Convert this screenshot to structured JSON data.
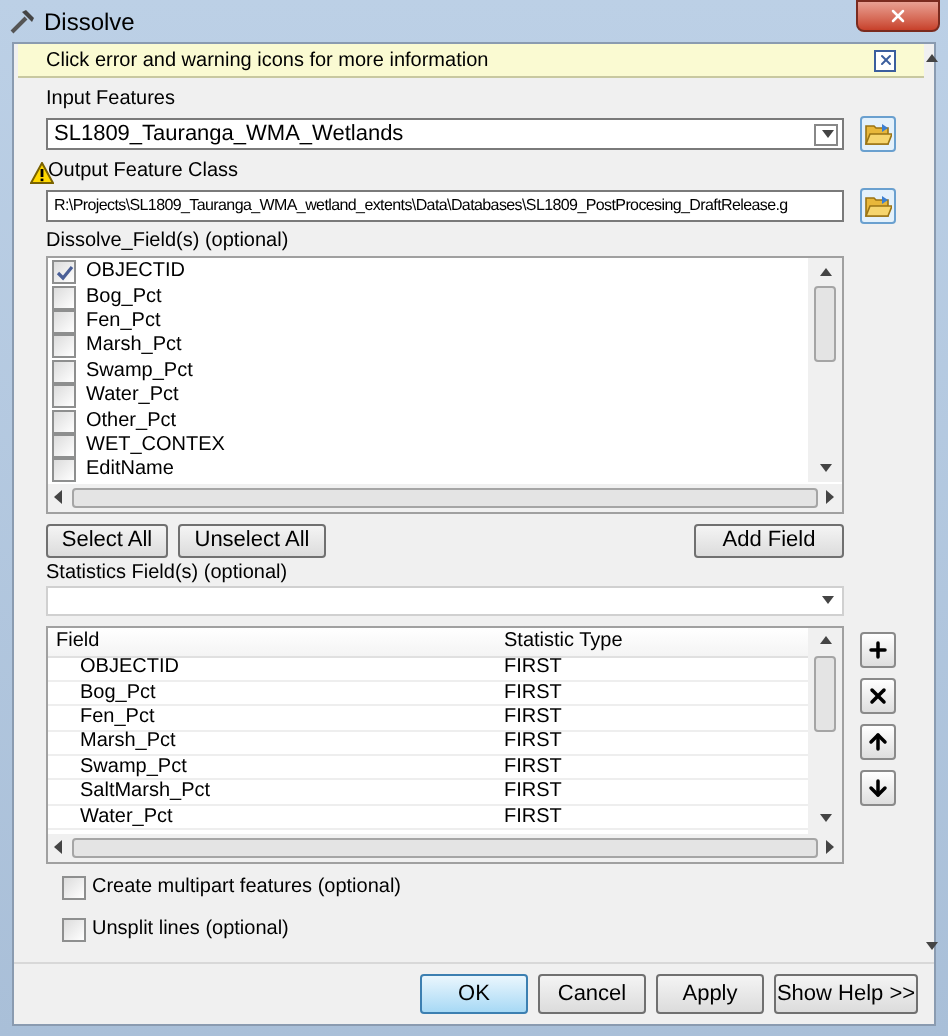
{
  "window": {
    "title": "Dissolve"
  },
  "info_bar": {
    "text": "Click error and warning icons for more information"
  },
  "input_features": {
    "label": "Input Features",
    "value": "SL1809_Tauranga_WMA_Wetlands"
  },
  "output_feature_class": {
    "label": "Output Feature Class",
    "value": "R:\\Projects\\SL1809_Tauranga_WMA_wetland_extents\\Data\\Databases\\SL1809_PostProcesing_DraftRelease.g",
    "warning": true
  },
  "dissolve_fields": {
    "label": "Dissolve_Field(s) (optional)",
    "items": [
      {
        "name": "OBJECTID",
        "checked": true
      },
      {
        "name": "Bog_Pct",
        "checked": false
      },
      {
        "name": "Fen_Pct",
        "checked": false
      },
      {
        "name": "Marsh_Pct",
        "checked": false
      },
      {
        "name": "Swamp_Pct",
        "checked": false
      },
      {
        "name": "Water_Pct",
        "checked": false
      },
      {
        "name": "Other_Pct",
        "checked": false
      },
      {
        "name": "WET_CONTEX",
        "checked": false
      },
      {
        "name": "EditName",
        "checked": false
      }
    ]
  },
  "field_buttons": [
    "Select All",
    "Unselect All",
    "Add Field"
  ],
  "statistics_fields": {
    "label": "Statistics Field(s) (optional)",
    "columns": [
      "Field",
      "Statistic Type"
    ],
    "rows": [
      {
        "field": "OBJECTID",
        "statistic": "FIRST"
      },
      {
        "field": "Bog_Pct",
        "statistic": "FIRST"
      },
      {
        "field": "Fen_Pct",
        "statistic": "FIRST"
      },
      {
        "field": "Marsh_Pct",
        "statistic": "FIRST"
      },
      {
        "field": "Swamp_Pct",
        "statistic": "FIRST"
      },
      {
        "field": "SaltMarsh_Pct",
        "statistic": "FIRST"
      },
      {
        "field": "Water_Pct",
        "statistic": "FIRST"
      }
    ]
  },
  "options": [
    {
      "label": "Create multipart features (optional)",
      "checked": false
    },
    {
      "label": "Unsplit lines (optional)",
      "checked": false
    }
  ],
  "footer_buttons": [
    {
      "label": "OK",
      "default": true
    },
    {
      "label": "Cancel",
      "default": false
    },
    {
      "label": "Apply",
      "default": false
    },
    {
      "label": "Show Help >>",
      "default": false
    }
  ]
}
